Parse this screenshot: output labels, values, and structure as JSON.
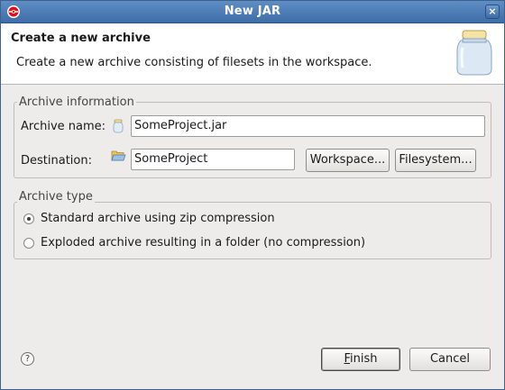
{
  "window": {
    "title": "New JAR",
    "close_label": "×"
  },
  "banner": {
    "title": "Create a new archive",
    "description": "Create a new archive consisting of filesets in the workspace."
  },
  "archive_info": {
    "group_label": "Archive information",
    "name_label": "Archive name:",
    "name_value": "SomeProject.jar",
    "destination_label": "Destination:",
    "destination_value": "SomeProject",
    "workspace_button": "Workspace...",
    "filesystem_button": "Filesystem..."
  },
  "archive_type": {
    "group_label": "Archive type",
    "options": [
      {
        "label": "Standard archive using zip compression",
        "checked": true
      },
      {
        "label": "Exploded archive resulting in a folder (no compression)",
        "checked": false
      }
    ]
  },
  "footer": {
    "help_label": "?",
    "finish_mnemonic": "F",
    "finish_rest": "inish",
    "cancel_label": "Cancel"
  }
}
